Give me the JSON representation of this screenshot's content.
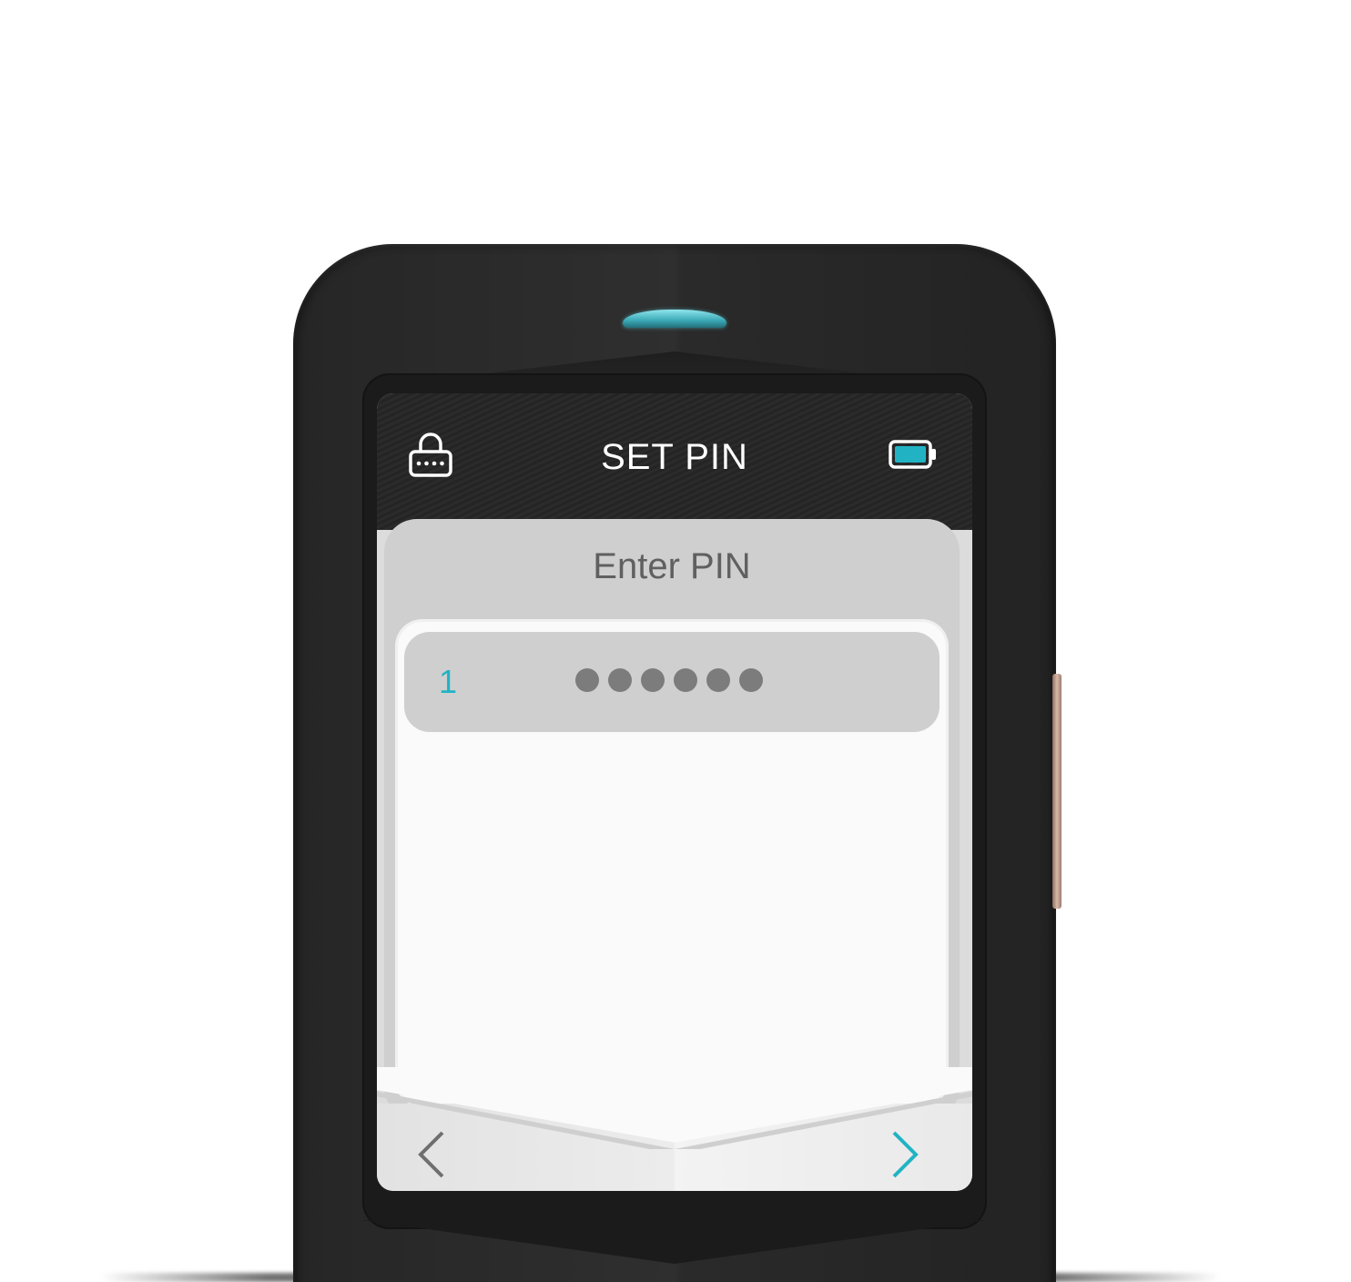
{
  "header": {
    "title": "SET PIN",
    "lock_icon": "lock-icon",
    "battery_icon": "battery-icon"
  },
  "card": {
    "title": "Enter PIN"
  },
  "pin_entry": {
    "index": "1",
    "masked_digit_count": 6
  },
  "navigation": {
    "prev_icon": "chevron-left-icon",
    "next_icon": "chevron-right-icon"
  },
  "colors": {
    "accent": "#21b3c3",
    "led": "#5cc7d2",
    "dot": "#7c7c7c",
    "nav_prev": "#6f6f6f"
  }
}
